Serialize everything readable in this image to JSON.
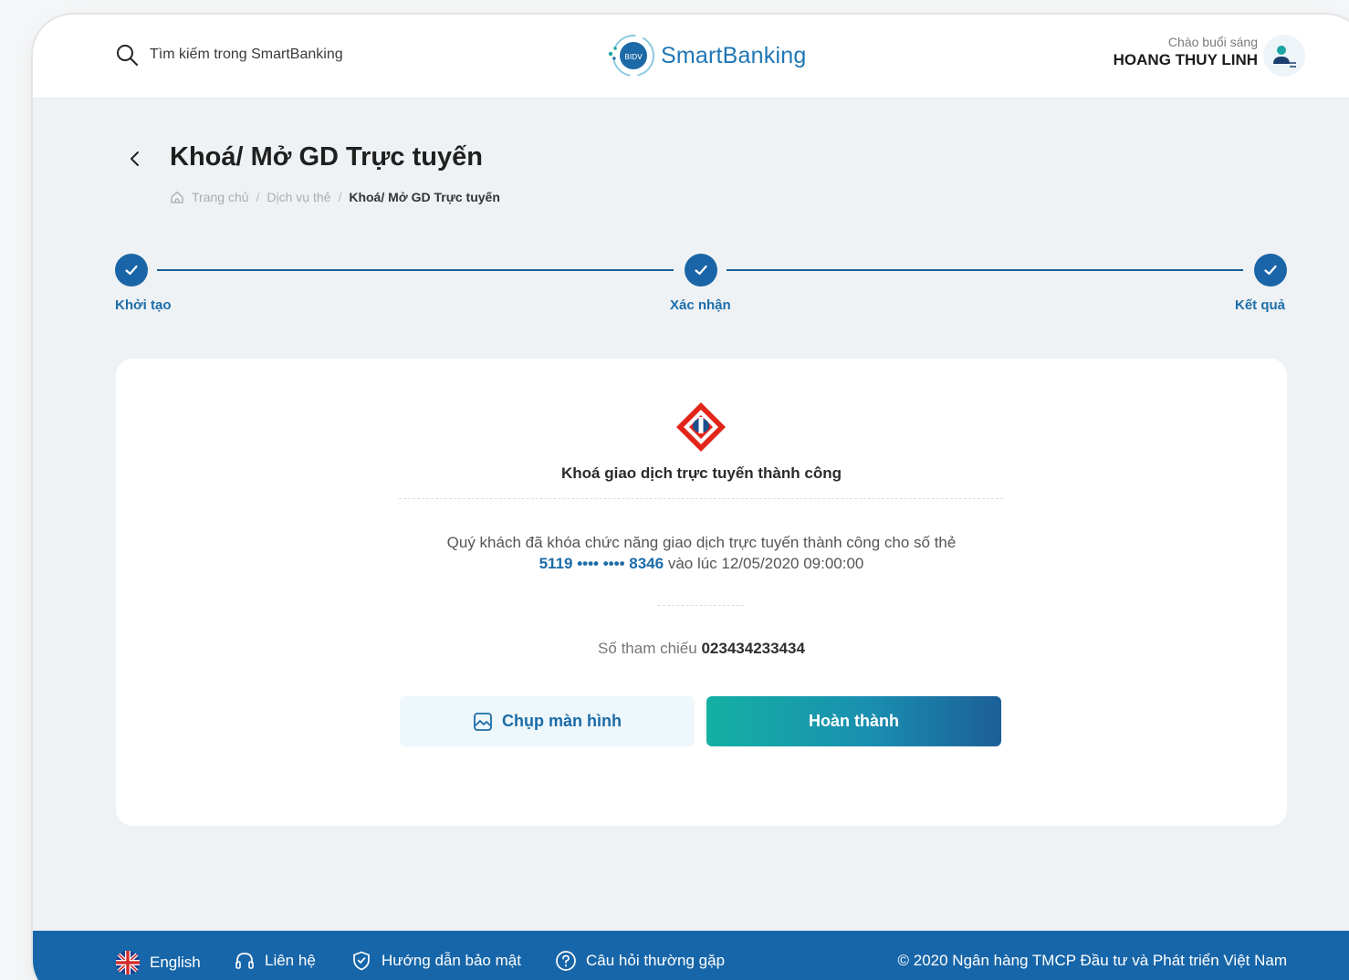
{
  "header": {
    "search_placeholder": "Tìm kiếm trong SmartBanking",
    "brand": "SmartBanking",
    "logo_badge": "BIDV",
    "greeting": "Chào buổi sáng",
    "user_name": "HOANG THUY LINH"
  },
  "page": {
    "title": "Khoá/ Mở GD Trực tuyến",
    "breadcrumb": [
      "Trang chủ",
      "Dịch vụ thẻ",
      "Khoá/ Mở GD Trực tuyến"
    ]
  },
  "stepper": {
    "steps": [
      {
        "label": "Khởi tạo",
        "done": true
      },
      {
        "label": "Xác nhận",
        "done": true
      },
      {
        "label": "Kết quả",
        "done": true
      }
    ]
  },
  "result": {
    "title": "Khoá giao dịch trực tuyến thành công",
    "message_line1": "Quý khách đã khóa chức năng giao dịch trực tuyến thành công cho số thẻ",
    "card_number": "5119 •••• •••• 8346",
    "message_time": "vào lúc 12/05/2020 09:00:00",
    "ref_label": "Số tham chiếu",
    "ref_value": "023434233434",
    "screenshot_button": "Chụp màn hình",
    "done_button": "Hoàn thành"
  },
  "footer": {
    "language": "English",
    "contact": "Liên hệ",
    "security_guide": "Hướng dẫn bảo mật",
    "faq": "Câu hỏi thường gặp",
    "copyright": "© 2020 Ngân hàng TMCP Đầu tư và Phát triển Việt Nam"
  },
  "colors": {
    "primary": "#1a65a7",
    "accent_teal": "#14b0a3",
    "footer": "#1766a9",
    "emblem_red": "#e1251b"
  }
}
